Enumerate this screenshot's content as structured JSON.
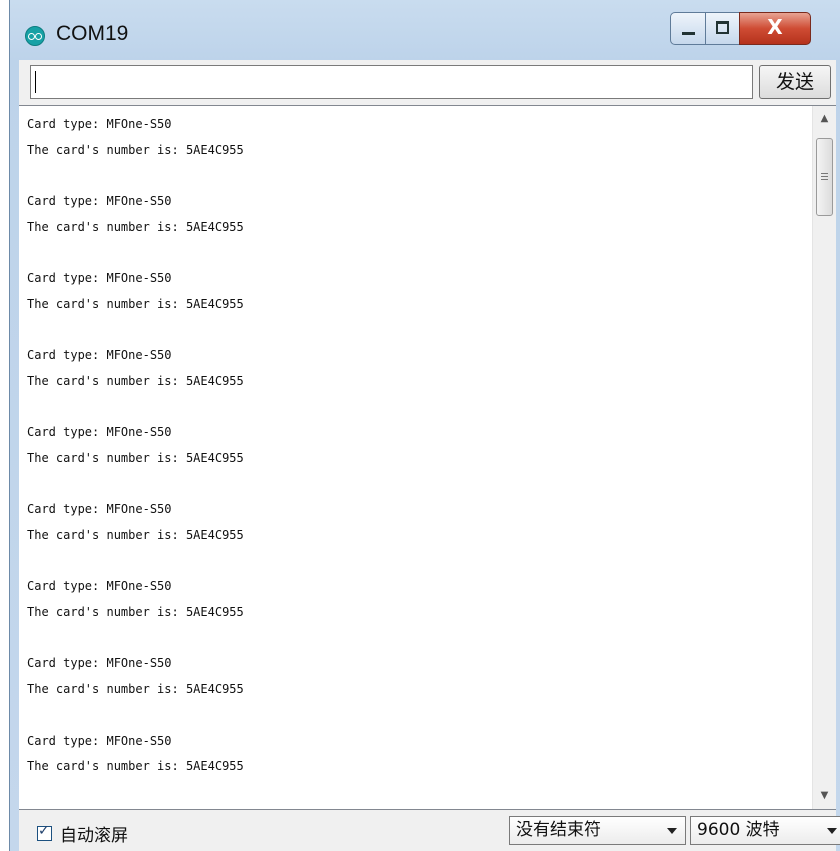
{
  "window": {
    "title": "COM19"
  },
  "send_bar": {
    "input_value": "",
    "send_label": "发送"
  },
  "console": {
    "lines": [
      "Card type: MFOne-S50",
      "The card's number is: 5AE4C955",
      "",
      "Card type: MFOne-S50",
      "The card's number is: 5AE4C955",
      "",
      "Card type: MFOne-S50",
      "The card's number is: 5AE4C955",
      "",
      "Card type: MFOne-S50",
      "The card's number is: 5AE4C955",
      "",
      "Card type: MFOne-S50",
      "The card's number is: 5AE4C955",
      "",
      "Card type: MFOne-S50",
      "The card's number is: 5AE4C955",
      "",
      "Card type: MFOne-S50",
      "The card's number is: 5AE4C955",
      "",
      "Card type: MFOne-S50",
      "The card's number is: 5AE4C955",
      "",
      "Card type: MFOne-S50",
      "The card's number is: 5AE4C955"
    ]
  },
  "status_bar": {
    "autoscroll_label": "自动滚屏",
    "autoscroll_checked": true,
    "line_ending": "没有结束符",
    "baud_rate": "9600 波特"
  },
  "colors": {
    "title_bar": "#bdd3ea",
    "close_button": "#cf4c34",
    "app_icon": "#17a1a5"
  },
  "icons": {
    "app": "arduino-icon",
    "minimize": "minimize-icon",
    "maximize": "maximize-icon",
    "close": "close-icon",
    "scroll_up": "scroll-up-arrow-icon",
    "scroll_down": "scroll-down-arrow-icon",
    "dropdown": "chevron-down-icon"
  }
}
